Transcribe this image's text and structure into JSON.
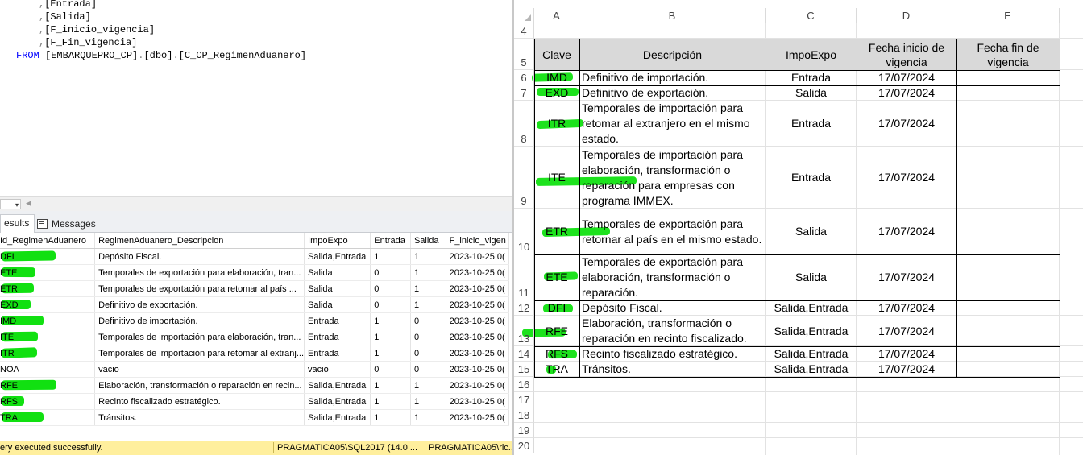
{
  "query": {
    "lines": [
      ",[Entrada]",
      ",[Salida]",
      ",[F_inicio_vigencia]",
      ",[F_Fin_vigencia]"
    ],
    "from_keyword": "FROM",
    "from_db": "[EMBARQUEPRO_CP]",
    "from_schema": "[dbo]",
    "from_table": "[C_CP_RegimenAduanero]"
  },
  "results_tabs": {
    "results": "esults",
    "messages": "Messages"
  },
  "results_grid": {
    "columns": [
      "Id_RegimenAduanero",
      "RegimenAduanero_Descripcion",
      "ImpoExpo",
      "Entrada",
      "Salida",
      "F_inicio_vigen"
    ],
    "rows": [
      [
        "DFI",
        "Depósito Fiscal.",
        "Salida,Entrada",
        "1",
        "1",
        "2023-10-25 0("
      ],
      [
        "ETE",
        "Temporales de exportación para elaboración, tran...",
        "Salida",
        "0",
        "1",
        "2023-10-25 0("
      ],
      [
        "ETR",
        "Temporales de exportación para retomar al país ...",
        "Salida",
        "0",
        "1",
        "2023-10-25 0("
      ],
      [
        "EXD",
        "Definitivo de exportación.",
        "Salida",
        "0",
        "1",
        "2023-10-25 0("
      ],
      [
        "IMD",
        "Definitivo de importación.",
        "Entrada",
        "1",
        "0",
        "2023-10-25 0("
      ],
      [
        "ITE",
        "Temporales de importación para elaboración, tran...",
        "Entrada",
        "1",
        "0",
        "2023-10-25 0("
      ],
      [
        "ITR",
        "Temporales de importación para retomar al extranj...",
        "Entrada",
        "1",
        "0",
        "2023-10-25 0("
      ],
      [
        "NOA",
        "vacio",
        "vacio",
        "0",
        "0",
        "2023-10-25 0("
      ],
      [
        "RFE",
        "Elaboración, transformación o reparación en recin...",
        "Salida,Entrada",
        "1",
        "1",
        "2023-10-25 0("
      ],
      [
        "RFS",
        "Recinto fiscalizado estratégico.",
        "Salida,Entrada",
        "1",
        "1",
        "2023-10-25 0("
      ],
      [
        "TRA",
        "Tránsitos.",
        "Salida,Entrada",
        "1",
        "1",
        "2023-10-25 0("
      ]
    ]
  },
  "status_bar": {
    "message": "ery executed successfully.",
    "server": "PRAGMATICA05\\SQL2017 (14.0 ...",
    "user": "PRAGMATICA05\\ric..."
  },
  "spreadsheet": {
    "col_letters": [
      "A",
      "B",
      "C",
      "D",
      "E"
    ],
    "header_row_number": "5",
    "top_row_number": "4",
    "headers": [
      "Clave",
      "Descripción",
      "ImpoExpo",
      "Fecha inicio de vigencia",
      "Fecha fin de vigencia"
    ],
    "rows": [
      {
        "num": "6",
        "clave": "IMD",
        "desc": "Definitivo de importación.",
        "impoexpo": "Entrada",
        "fecha_inicio": "17/07/2024",
        "fecha_fin": ""
      },
      {
        "num": "7",
        "clave": "EXD",
        "desc": "Definitivo de exportación.",
        "impoexpo": "Salida",
        "fecha_inicio": "17/07/2024",
        "fecha_fin": ""
      },
      {
        "num": "8",
        "clave": "ITR",
        "desc": "Temporales de importación para retomar al extranjero en el mismo estado.",
        "impoexpo": "Entrada",
        "fecha_inicio": "17/07/2024",
        "fecha_fin": ""
      },
      {
        "num": "9",
        "clave": "ITE",
        "desc": "Temporales de importación para elaboración, transformación o reparación para empresas con programa IMMEX.",
        "impoexpo": "Entrada",
        "fecha_inicio": "17/07/2024",
        "fecha_fin": ""
      },
      {
        "num": "10",
        "clave": "ETR",
        "desc": "Temporales de exportación para retornar al país en el mismo estado.",
        "impoexpo": "Salida",
        "fecha_inicio": "17/07/2024",
        "fecha_fin": ""
      },
      {
        "num": "11",
        "clave": "ETE",
        "desc": "Temporales de exportación para elaboración, transformación o reparación.",
        "impoexpo": "Salida",
        "fecha_inicio": "17/07/2024",
        "fecha_fin": ""
      },
      {
        "num": "12",
        "clave": "DFI",
        "desc": "Depósito Fiscal.",
        "impoexpo": "Salida,Entrada",
        "fecha_inicio": "17/07/2024",
        "fecha_fin": ""
      },
      {
        "num": "13",
        "clave": "RFE",
        "desc": "Elaboración, transformación o reparación en recinto fiscalizado.",
        "impoexpo": "Salida,Entrada",
        "fecha_inicio": "17/07/2024",
        "fecha_fin": ""
      },
      {
        "num": "14",
        "clave": "RFS",
        "desc": "Recinto fiscalizado estratégico.",
        "impoexpo": "Salida,Entrada",
        "fecha_inicio": "17/07/2024",
        "fecha_fin": ""
      },
      {
        "num": "15",
        "clave": "TRA",
        "desc": "Tránsitos.",
        "impoexpo": "Salida,Entrada",
        "fecha_inicio": "17/07/2024",
        "fecha_fin": ""
      }
    ],
    "empty_rows": [
      "16",
      "17",
      "18",
      "19",
      "20"
    ]
  },
  "highlight_color": "#11e011"
}
